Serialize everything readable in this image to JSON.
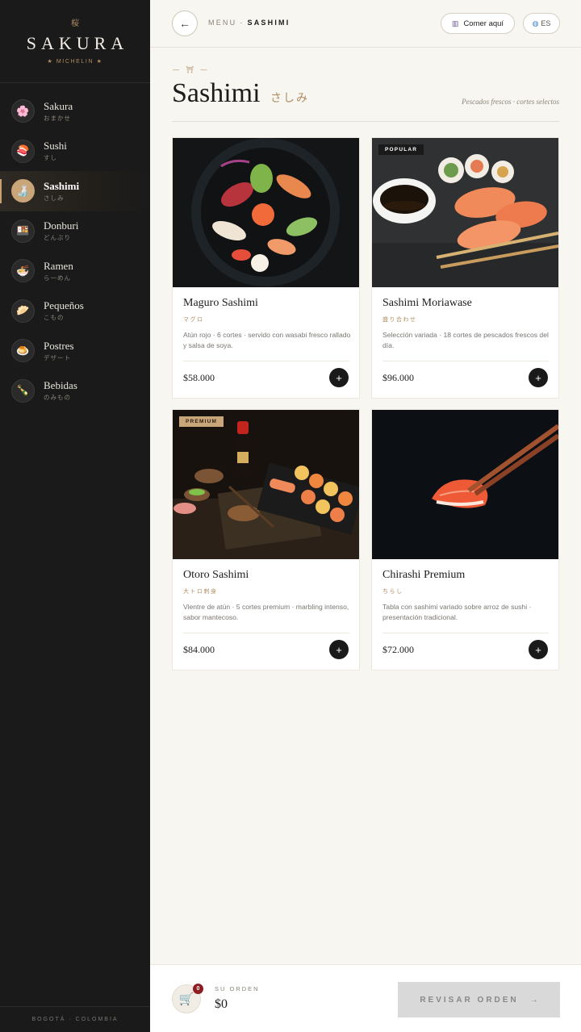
{
  "brand": {
    "kanji": "桜",
    "name": "SAKURA",
    "tagline": "★ MICHELIN ★"
  },
  "sidebar": {
    "items": [
      {
        "label": "Sakura",
        "sub": "おまかせ",
        "icon": "cherry-blossom-icon",
        "glyph": "🌸",
        "active": false
      },
      {
        "label": "Sushi",
        "sub": "すし",
        "icon": "sushi-icon",
        "glyph": "🍣",
        "active": false
      },
      {
        "label": "Sashimi",
        "sub": "さしみ",
        "icon": "sashimi-icon",
        "glyph": "🍶",
        "active": true
      },
      {
        "label": "Donburi",
        "sub": "どんぶり",
        "icon": "donburi-icon",
        "glyph": "🍱",
        "active": false
      },
      {
        "label": "Ramen",
        "sub": "ら一めん",
        "icon": "ramen-icon",
        "glyph": "🍜",
        "active": false
      },
      {
        "label": "Pequeños",
        "sub": "こもの",
        "icon": "dumpling-icon",
        "glyph": "🥟",
        "active": false
      },
      {
        "label": "Postres",
        "sub": "デザート",
        "icon": "dessert-icon",
        "glyph": "🍮",
        "active": false
      },
      {
        "label": "Bebidas",
        "sub": "のみもの",
        "icon": "drink-bottle-icon",
        "glyph": "🍾",
        "active": false
      }
    ],
    "footer": "BOGOTÁ · COLOMBIA"
  },
  "header": {
    "back_glyph": "←",
    "breadcrumb_root": "MENU",
    "breadcrumb_sep": "·",
    "breadcrumb_current": "SASHIMI",
    "dine_label": "Comer aquí",
    "lang_label": "ES"
  },
  "page": {
    "ornament": "— ⛩ —",
    "title": "Sashimi",
    "title_jp": "さしみ",
    "subtitle": "Pescados frescos · cortes selectos"
  },
  "colors": {
    "accent": "#b08d62",
    "sidebar_bg": "#1a1a1a",
    "page_bg": "#f8f6f1",
    "badge_count": "#8e1d22"
  },
  "products": [
    {
      "name": "Maguro Sashimi",
      "jp": "マグロ",
      "desc": "Atún rojo · 6 cortes · servido con wasabi fresco rallado y salsa de soya.",
      "price": "$58.000",
      "badge": ""
    },
    {
      "name": "Sashimi Moriawase",
      "jp": "盛り合わせ",
      "desc": "Selección variada · 18 cortes de pescados frescos del día.",
      "price": "$96.000",
      "badge": "POPULAR"
    },
    {
      "name": "Otoro Sashimi",
      "jp": "大トロ刺身",
      "desc": "Vientre de atún · 5 cortes premium · marbling intenso, sabor mantecoso.",
      "price": "$84.000",
      "badge": "PREMIUM"
    },
    {
      "name": "Chirashi Premium",
      "jp": "ちらし",
      "desc": "Tabla con sashimi variado sobre arroz de sushi · presentación tradicional.",
      "price": "$72.000",
      "badge": ""
    }
  ],
  "order": {
    "count": "0",
    "label": "SU ORDEN",
    "total": "$0",
    "review_label": "REVISAR ORDEN",
    "review_arrow": "→"
  }
}
